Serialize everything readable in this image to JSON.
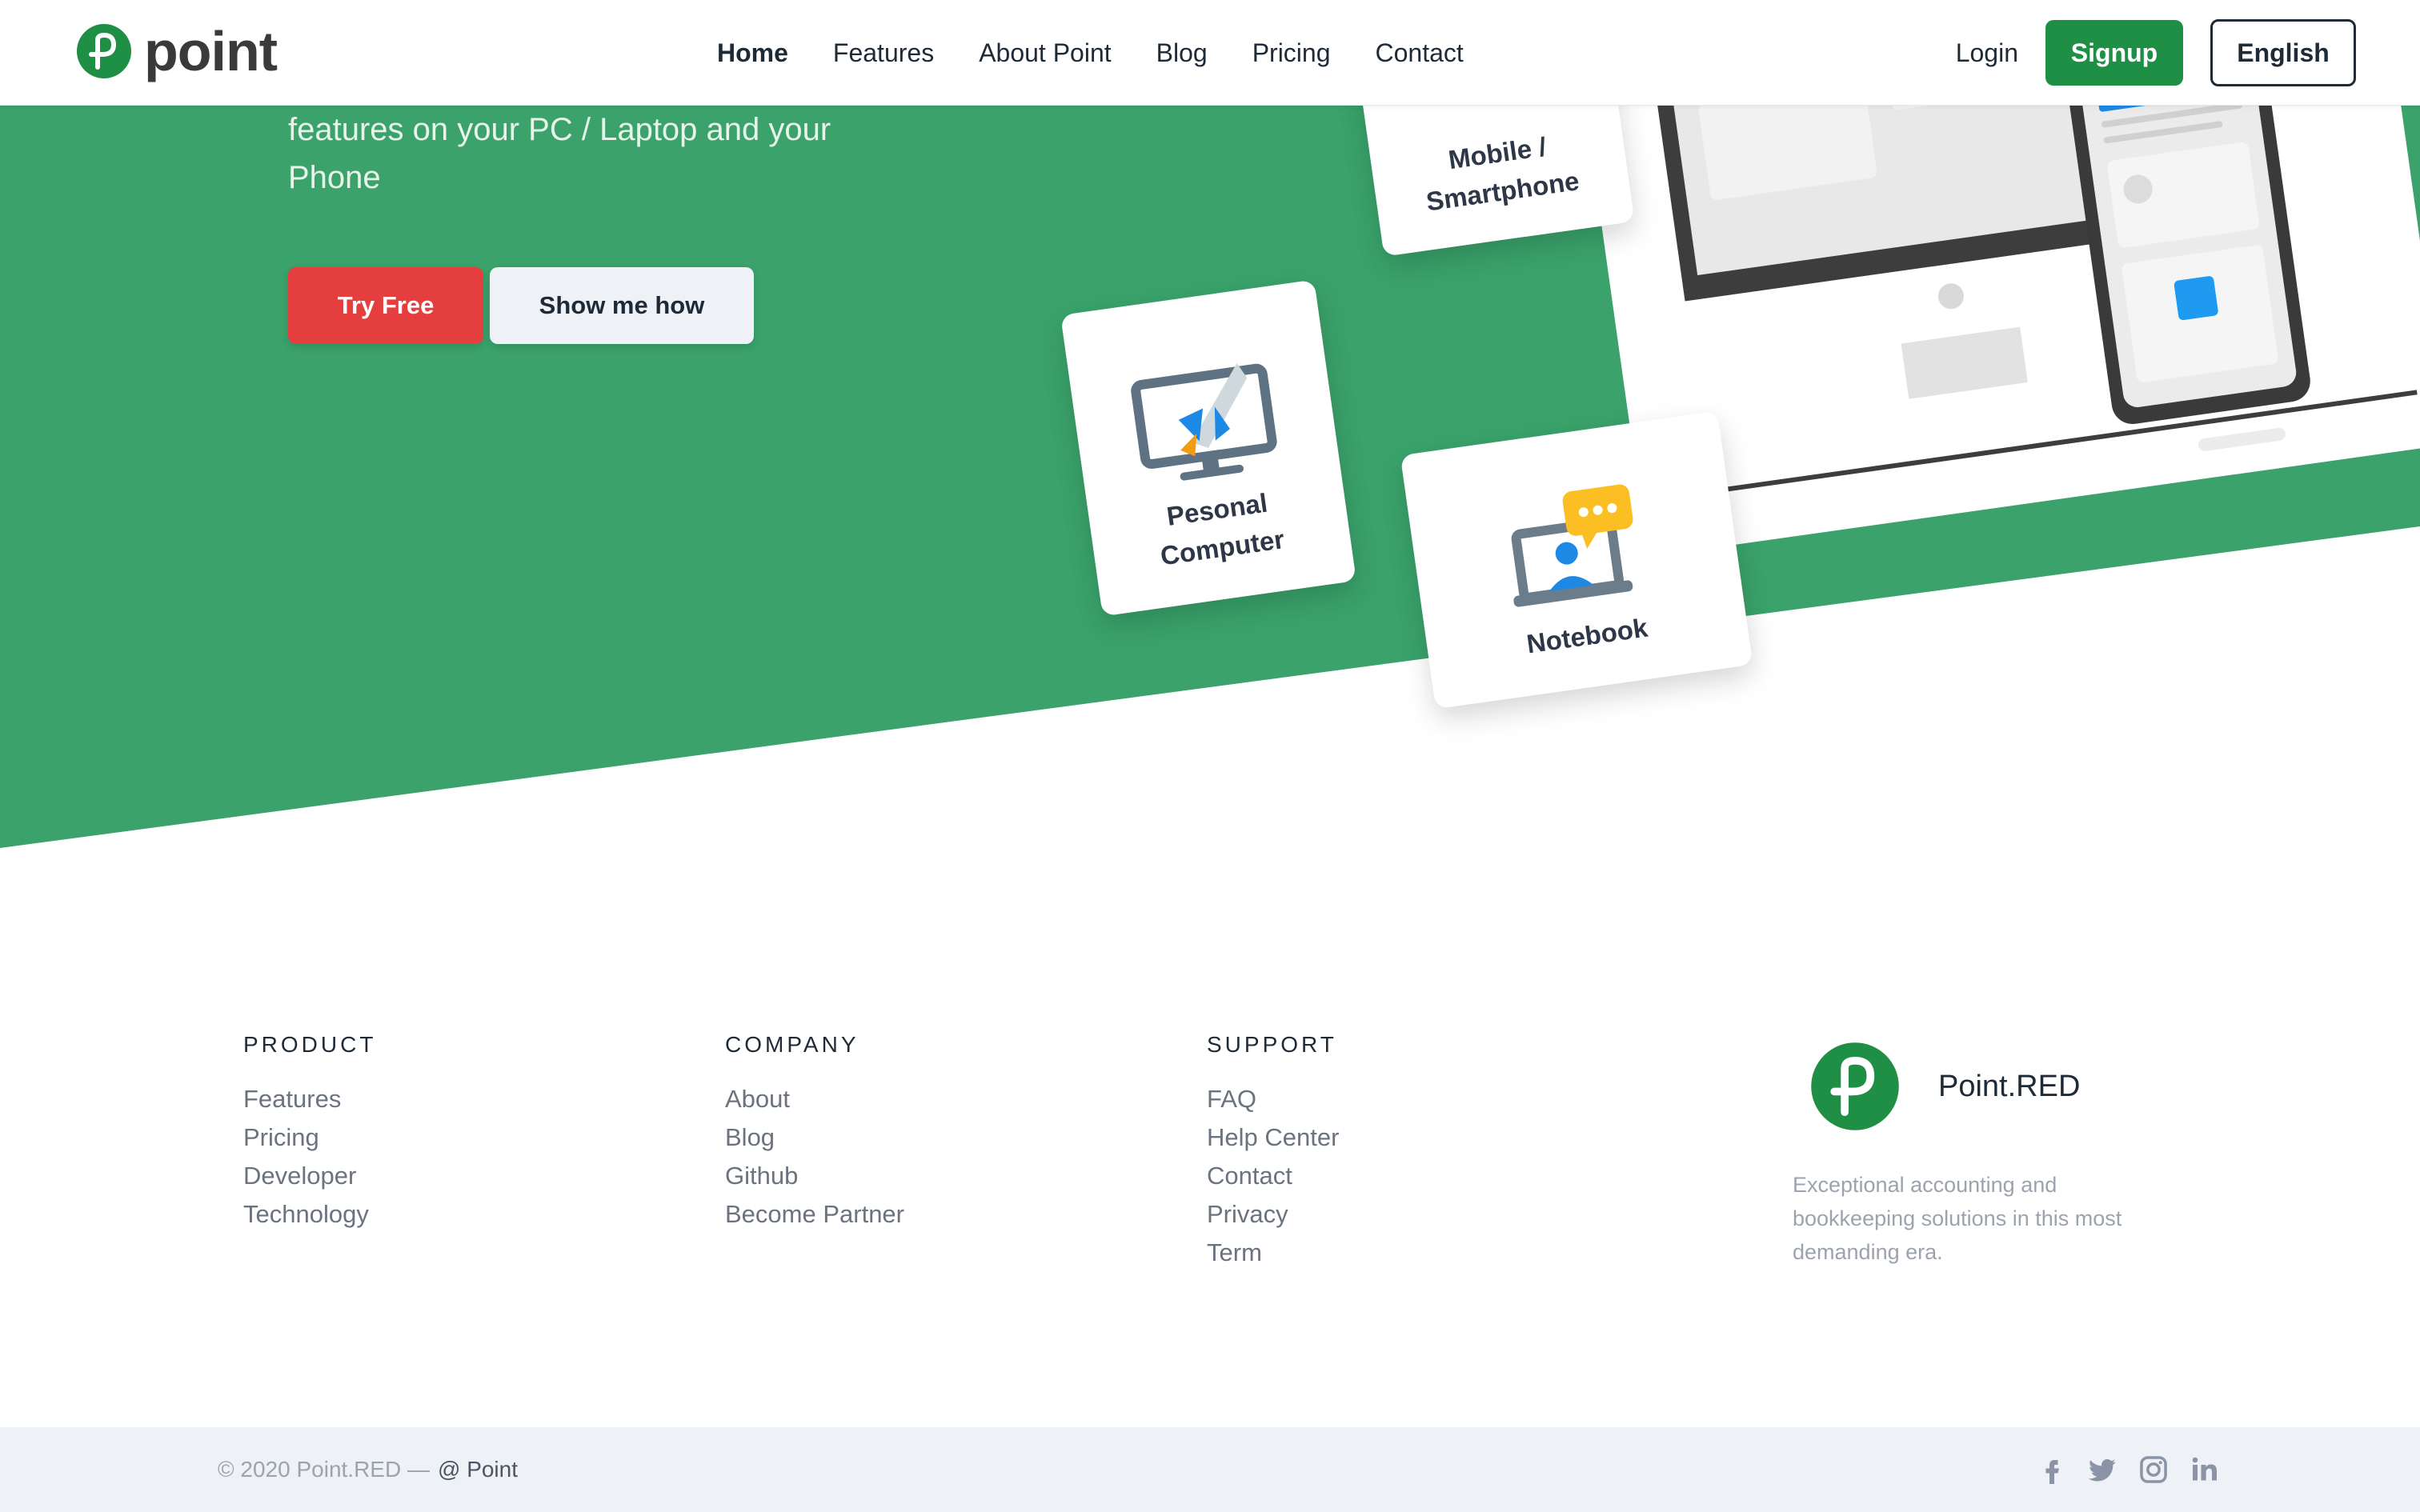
{
  "navbar": {
    "logo_text": "point",
    "links": [
      "Home",
      "Features",
      "About Point",
      "Blog",
      "Pricing",
      "Contact"
    ],
    "login": "Login",
    "signup": "Signup",
    "language": "English"
  },
  "hero": {
    "text_line1": "features on your PC / Laptop and your",
    "text_line2": "Phone",
    "try_free": "Try Free",
    "show_me_how": "Show me how",
    "cards": {
      "mobile_line1": "Mobile /",
      "mobile_line2": "Smartphone",
      "pc_line1": "Pesonal",
      "pc_line2": "Computer",
      "notebook": "Notebook"
    }
  },
  "footer": {
    "columns": [
      {
        "heading": "PRODUCT",
        "links": [
          "Features",
          "Pricing",
          "Developer",
          "Technology"
        ]
      },
      {
        "heading": "COMPANY",
        "links": [
          "About",
          "Blog",
          "Github",
          "Become Partner"
        ]
      },
      {
        "heading": "SUPPORT",
        "links": [
          "FAQ",
          "Help Center",
          "Contact",
          "Privacy",
          "Term"
        ]
      }
    ],
    "brand_name": "Point.RED",
    "brand_desc_line1": "Exceptional accounting and",
    "brand_desc_line2": "bookkeeping solutions in this most",
    "brand_desc_line3": "demanding era.",
    "copyright": "© 2020 Point.RED —",
    "copyright_brand": "@ Point",
    "social_icons": [
      "facebook-icon",
      "twitter-icon",
      "instagram-icon",
      "linkedin-icon"
    ]
  },
  "colors": {
    "hero_green": "#3aa26a",
    "brand_green": "#1f8f45",
    "try_red": "#e53e3e"
  }
}
